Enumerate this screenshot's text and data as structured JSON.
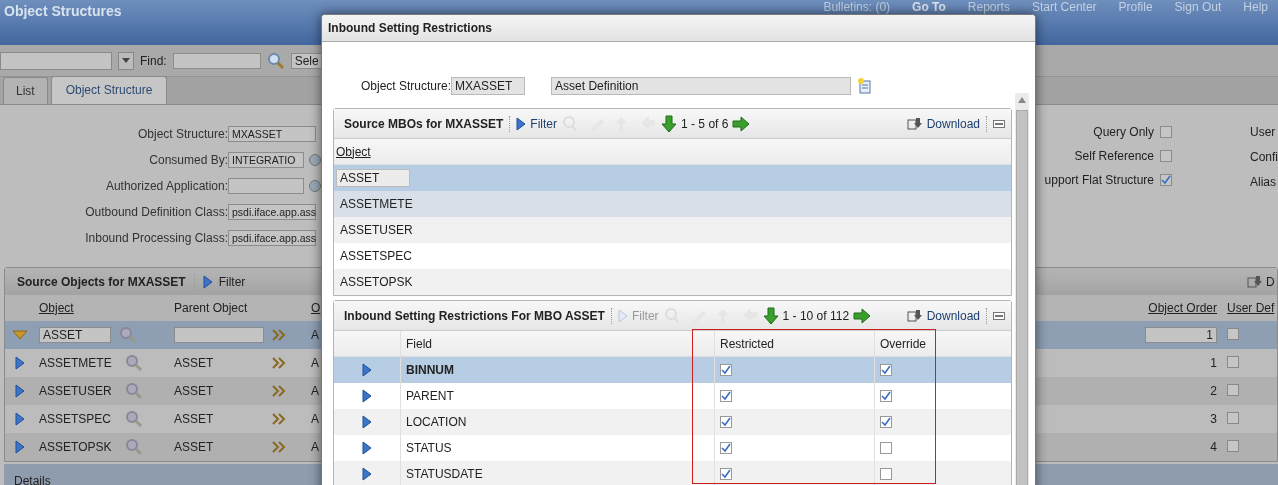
{
  "header": {
    "title": "Object Structures",
    "links": [
      {
        "label": "Bulletins: (0)",
        "kind": "text"
      },
      {
        "label": "Go To",
        "kind": "menu"
      },
      {
        "label": "Reports",
        "kind": "text"
      },
      {
        "label": "Start Center",
        "kind": "text"
      },
      {
        "label": "Profile",
        "kind": "text"
      },
      {
        "label": "Sign Out",
        "kind": "text"
      },
      {
        "label": "Help",
        "kind": "text"
      }
    ]
  },
  "toolbar": {
    "find_label": "Find:",
    "action_select": "Sele"
  },
  "tabs": [
    {
      "label": "List",
      "selected": false
    },
    {
      "label": "Object Structure",
      "selected": true
    }
  ],
  "form": {
    "fields": [
      {
        "label": "Object Structure:",
        "value": "MXASSET",
        "lookup": false
      },
      {
        "label": "Consumed By:",
        "value": "INTEGRATIO",
        "lookup": true
      },
      {
        "label": "Authorized Application:",
        "lookup": true
      },
      {
        "label": "Outbound Definition Class:",
        "value": "psdi.iface.app.ass",
        "lookup": false
      },
      {
        "label": "Inbound Processing Class:",
        "value": "psdi.iface.app.ass",
        "lookup": false
      }
    ],
    "flags": [
      {
        "label": "Query Only",
        "checked": false
      },
      {
        "label": "Self Reference",
        "checked": false
      },
      {
        "label": "upport Flat Structure",
        "checked": true
      }
    ],
    "right_labels": [
      "User",
      "Confi",
      "Alias"
    ]
  },
  "source_objects": {
    "title": "Source Objects for MXASSET",
    "filter": "Filter",
    "download": "D",
    "columns": [
      "Object",
      "Parent Object",
      "O",
      "Object Order",
      "User Def"
    ],
    "rows": [
      {
        "object": "ASSET",
        "column_3": "A",
        "order": "1",
        "user_defined": false,
        "selected": true
      },
      {
        "object": "ASSETMETE",
        "parent_object": "ASSET",
        "column_3": "A",
        "order": "1",
        "user_defined": false,
        "selected": false
      },
      {
        "object": "ASSETUSER",
        "parent_object": "ASSET",
        "column_3": "A",
        "order": "2",
        "user_defined": false,
        "selected": false
      },
      {
        "object": "ASSETSPEC",
        "parent_object": "ASSET",
        "column_3": "A",
        "order": "3",
        "user_defined": false,
        "selected": false
      },
      {
        "object": "ASSETOPSK",
        "parent_object": "ASSET",
        "column_3": "A",
        "order": "4",
        "user_defined": false,
        "selected": false
      }
    ]
  },
  "details": "Details",
  "dialog": {
    "title": "Inbound Setting Restrictions",
    "object_structure_label": "Object Structure:",
    "object_structure": "MXASSET",
    "description": "Asset Definition",
    "mbos": {
      "title": "Source MBOs for MXASSET",
      "filter": "Filter",
      "paging": "1 - 5 of 6",
      "download": "Download",
      "column": "Object",
      "rows": [
        {
          "object": "ASSET",
          "selected": true,
          "hovered": false
        },
        {
          "object": "ASSETMETE",
          "selected": false,
          "hovered": true
        },
        {
          "object": "ASSETUSER",
          "selected": false,
          "hovered": false
        },
        {
          "object": "ASSETSPEC",
          "selected": false,
          "hovered": false
        },
        {
          "object": "ASSETOPSK",
          "selected": false,
          "hovered": false
        }
      ]
    },
    "restrictions": {
      "title": "Inbound Setting Restrictions For MBO ASSET",
      "filter": "Filter",
      "paging": "1 - 10 of 112",
      "download": "Download",
      "columns": [
        "Field",
        "Restricted",
        "Override"
      ],
      "rows": [
        {
          "field": "BINNUM",
          "restricted": true,
          "override": true,
          "selected": true
        },
        {
          "field": "PARENT",
          "restricted": true,
          "override": true,
          "selected": false
        },
        {
          "field": "LOCATION",
          "restricted": true,
          "override": true,
          "selected": false
        },
        {
          "field": "STATUS",
          "restricted": true,
          "override": false,
          "selected": false
        },
        {
          "field": "STATUSDATE",
          "restricted": true,
          "override": false,
          "selected": false
        }
      ]
    }
  }
}
